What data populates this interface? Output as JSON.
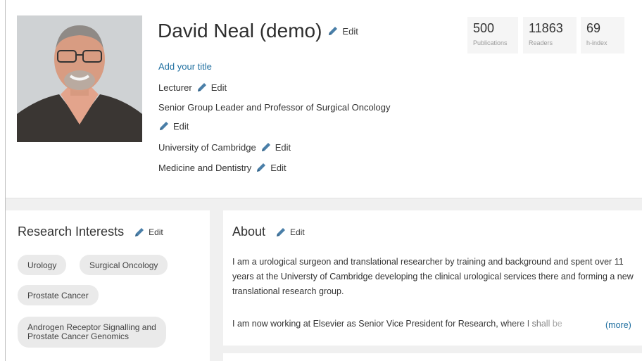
{
  "profile": {
    "name": "David Neal (demo)",
    "edit_label": "Edit",
    "add_title": "Add your title",
    "position": "Lecturer",
    "role": "Senior Group Leader and Professor of Surgical Oncology",
    "institution": "University of Cambridge",
    "discipline": "Medicine and Dentistry"
  },
  "metrics": [
    {
      "value": "500",
      "label": "Publications"
    },
    {
      "value": "11863",
      "label": "Readers"
    },
    {
      "value": "69",
      "label": "h-index"
    }
  ],
  "research": {
    "title": "Research Interests",
    "tags": [
      "Urology",
      "Surgical Oncology",
      "Prostate Cancer",
      "Androgen Receptor Signalling and",
      "Prostate Cancer Genomics"
    ]
  },
  "about": {
    "title": "About",
    "paragraph1": "I am a urological surgeon and translational researcher by training and background and spent over 11 years at the Universty of Cambridge developing the clinical urological services there and forming a new translational research group.",
    "paragraph2": "I am now working at Elsevier as Senior Vice President for Research, where I shall be",
    "more_label": "(more)"
  },
  "colors": {
    "link": "#1f6fa0",
    "edit_icon": "#4a7fa8",
    "chip_bg": "#eaeaea"
  },
  "icons": {
    "edit": "pencil-icon"
  }
}
